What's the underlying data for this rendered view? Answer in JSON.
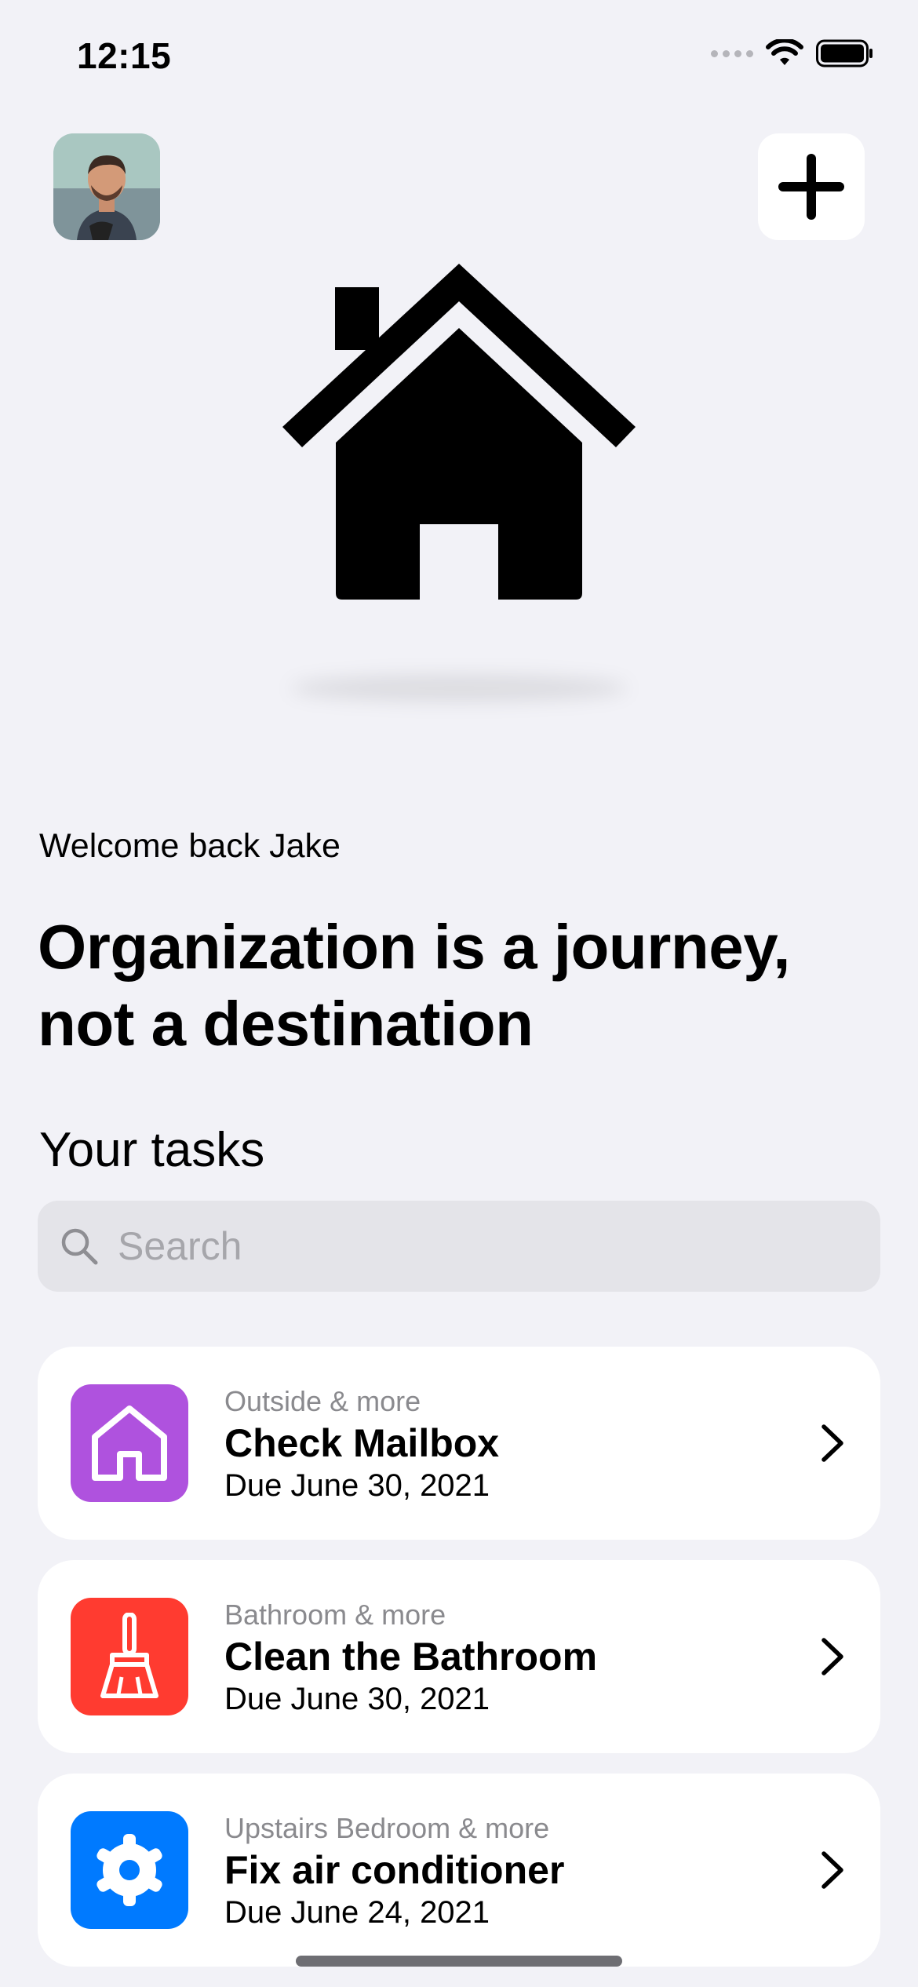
{
  "status_bar": {
    "time": "12:15"
  },
  "header": {
    "add_label": "+"
  },
  "welcome": "Welcome back Jake",
  "headline": "Organization is a journey, not a destination",
  "section_title": "Your tasks",
  "search": {
    "placeholder": "Search"
  },
  "tasks": [
    {
      "category": "Outside & more",
      "title": "Check Mailbox",
      "due": "Due June 30, 2021",
      "icon": "house-icon",
      "color": "#af52de"
    },
    {
      "category": "Bathroom & more",
      "title": "Clean the Bathroom",
      "due": "Due June 30, 2021",
      "icon": "broom-icon",
      "color": "#ff3b30"
    },
    {
      "category": "Upstairs Bedroom & more",
      "title": "Fix air conditioner",
      "due": "Due June 24, 2021",
      "icon": "gear-icon",
      "color": "#007aff"
    }
  ]
}
